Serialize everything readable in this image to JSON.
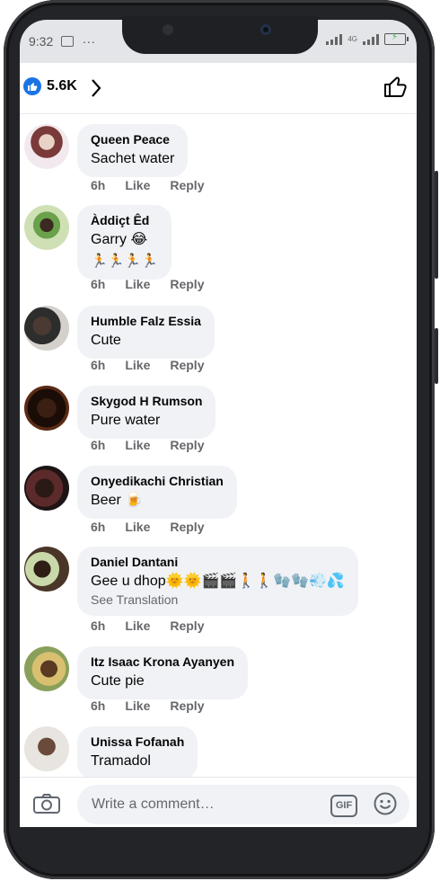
{
  "status": {
    "time": "9:32",
    "dots": "...",
    "network": "4G"
  },
  "header": {
    "like_count": "5.6K",
    "chevron": "›"
  },
  "comments": [
    {
      "name": "Queen Peace",
      "text": "Sachet water",
      "time": "6h",
      "like": "Like",
      "reply": "Reply"
    },
    {
      "name": "Àddiçt Êd",
      "text": "Garry 😂",
      "text2": "🏃🏃🏃🏃",
      "time": "6h",
      "like": "Like",
      "reply": "Reply"
    },
    {
      "name": "Humble Falz Essia",
      "text": "Cute",
      "time": "6h",
      "like": "Like",
      "reply": "Reply"
    },
    {
      "name": "Skygod H Rumson",
      "text": "Pure water",
      "time": "6h",
      "like": "Like",
      "reply": "Reply"
    },
    {
      "name": "Onyedikachi Christian",
      "text": "Beer 🍺",
      "time": "6h",
      "like": "Like",
      "reply": "Reply"
    },
    {
      "name": "Daniel Dantani",
      "text": "Gee u dhop🌞🌞🎬🎬🚶🚶🧤🧤💨💦",
      "translate": "See Translation",
      "time": "6h",
      "like": "Like",
      "reply": "Reply"
    },
    {
      "name": "Itz Isaac Krona Ayanyen",
      "text": "Cute pie",
      "time": "6h",
      "like": "Like",
      "reply": "Reply"
    },
    {
      "name": "Unissa Fofanah",
      "text": "Tramadol"
    }
  ],
  "composer": {
    "placeholder": "Write a comment…",
    "gif": "GIF"
  },
  "colors": {
    "accent": "#1b74e4",
    "bubble": "#f0f2f5",
    "meta": "#65676b"
  },
  "icons": [
    "like-badge-icon",
    "chevron-right-icon",
    "thumbs-up-icon",
    "camera-icon",
    "gif-icon",
    "smiley-icon"
  ]
}
